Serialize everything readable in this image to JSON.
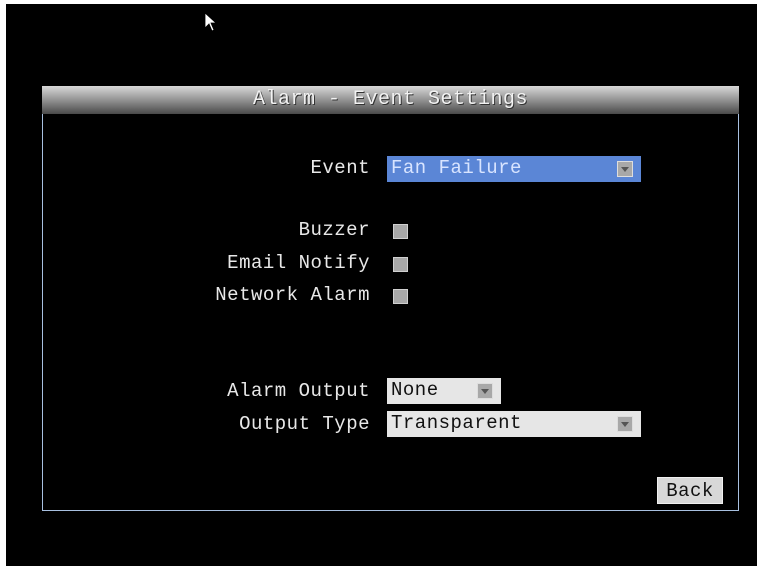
{
  "dialog": {
    "title": "Alarm - Event Settings"
  },
  "fields": {
    "event": {
      "label": "Event",
      "value": "Fan Failure"
    },
    "buzzer": {
      "label": "Buzzer",
      "checked": false
    },
    "email_notify": {
      "label": "Email Notify",
      "checked": false
    },
    "network_alarm": {
      "label": "Network Alarm",
      "checked": false
    },
    "alarm_output": {
      "label": "Alarm Output",
      "value": "None"
    },
    "output_type": {
      "label": "Output Type",
      "value": "Transparent"
    }
  },
  "buttons": {
    "back_label": "Back"
  },
  "icons": {
    "cursor": "mouse-pointer-icon",
    "dropdown": "dropdown-arrow-icon"
  },
  "colors": {
    "background": "#000000",
    "selected_field": "#5b86d6",
    "panel_border": "#a8c0e0"
  }
}
